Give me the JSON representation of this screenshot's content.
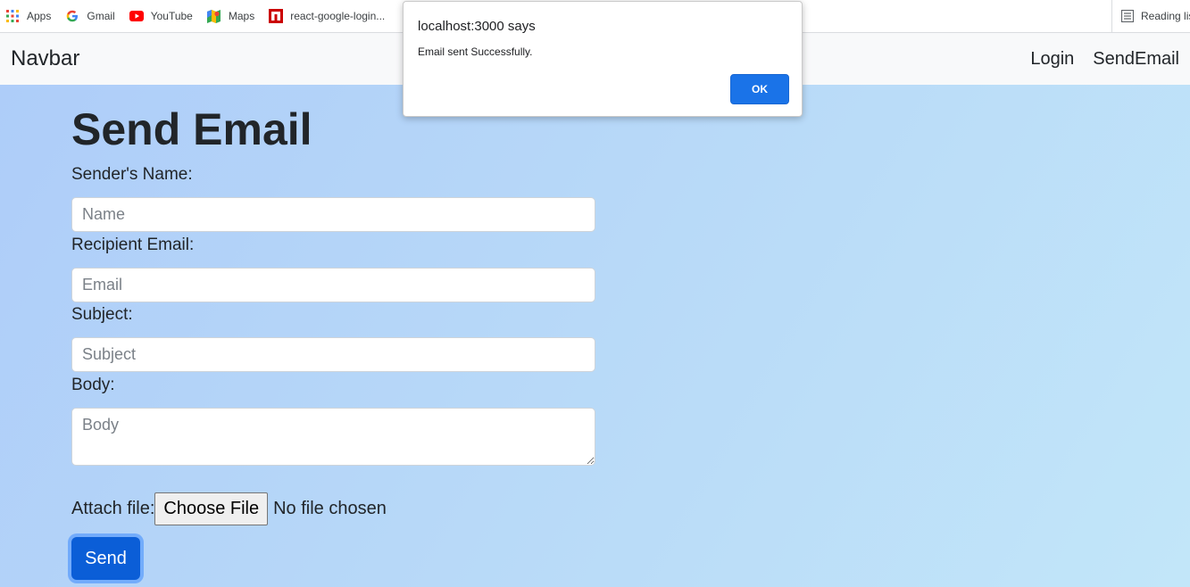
{
  "bookmarks": {
    "items": [
      {
        "label": "Apps",
        "icon": "apps-grid-icon"
      },
      {
        "label": "Gmail",
        "icon": "google-g-icon"
      },
      {
        "label": "YouTube",
        "icon": "youtube-icon"
      },
      {
        "label": "Maps",
        "icon": "maps-icon"
      },
      {
        "label": "react-google-login...",
        "icon": "npm-icon"
      }
    ],
    "reading_list": "Reading list"
  },
  "navbar": {
    "brand": "Navbar",
    "links": [
      "Login",
      "SendEmail"
    ]
  },
  "form": {
    "title": "Send Email",
    "sender_label": "Sender's Name:",
    "sender_placeholder": "Name",
    "recipient_label": "Recipient Email:",
    "recipient_placeholder": "Email",
    "subject_label": "Subject:",
    "subject_placeholder": "Subject",
    "body_label": "Body:",
    "body_placeholder": "Body",
    "attach_label": "Attach file:",
    "choose_file_label": "Choose File",
    "no_file_text": "No file chosen",
    "send_label": "Send"
  },
  "dialog": {
    "title": "localhost:3000 says",
    "message": "Email sent Successfully.",
    "ok_label": "OK"
  },
  "colors": {
    "primary": "#0b5ed7",
    "dialog_button": "#1a73e8",
    "navbar_bg": "#f8f9fa"
  }
}
